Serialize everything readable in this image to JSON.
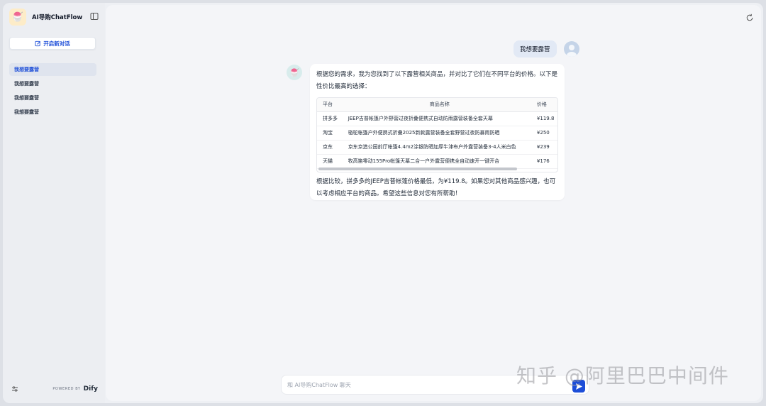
{
  "app": {
    "title": "AI导购ChatFlow",
    "logo_icon": "🍧"
  },
  "sidebar": {
    "new_chat_label": "开启新对话",
    "conversations": [
      {
        "label": "我想要露营",
        "active": true
      },
      {
        "label": "我想要露营",
        "active": false
      },
      {
        "label": "我想要露营",
        "active": false
      },
      {
        "label": "我想要露营",
        "active": false
      }
    ],
    "powered_by": "POWERED BY",
    "brand": "Dify"
  },
  "chat": {
    "user_message": "我想要露营",
    "bot_intro": "根据您的需求，我为您找到了以下露营相关商品，并对比了它们在不同平台的价格。以下是性价比最高的选择：",
    "table": {
      "headers": [
        "平台",
        "商品名称",
        "价格"
      ],
      "rows": [
        [
          "拼多多",
          "JEEP吉普帐篷户外野营过夜折叠便携式自动防雨露营装备全套天幕",
          "¥119.8"
        ],
        [
          "淘宝",
          "骆驼帐篷户外便携式折叠2025新款露营装备全套野营过夜防暴雨防晒",
          "¥250"
        ],
        [
          "京东",
          "京东京造公园前厅帐篷4.4m2涂银防晒加厚牛津布户外露营装备3-4人米白色",
          "¥239"
        ],
        [
          "天猫",
          "牧高笛零动155Pro帐篷天幕二合一户外露营便携全自动速开一键开合",
          "¥176"
        ]
      ]
    },
    "bot_conclusion": "根据比较，拼多多的JEEP吉普帐篷价格最低，为¥119.8。如果您对其他商品感兴趣，也可以考虑相应平台的商品。希望这些信息对您有所帮助！"
  },
  "input": {
    "placeholder": "和 AI导购ChatFlow 聊天"
  },
  "watermark": "知乎 @阿里巴巴中间件",
  "colors": {
    "accent": "#1d4ed8",
    "background": "#f4f5f8",
    "sidebar": "#eceef2"
  }
}
